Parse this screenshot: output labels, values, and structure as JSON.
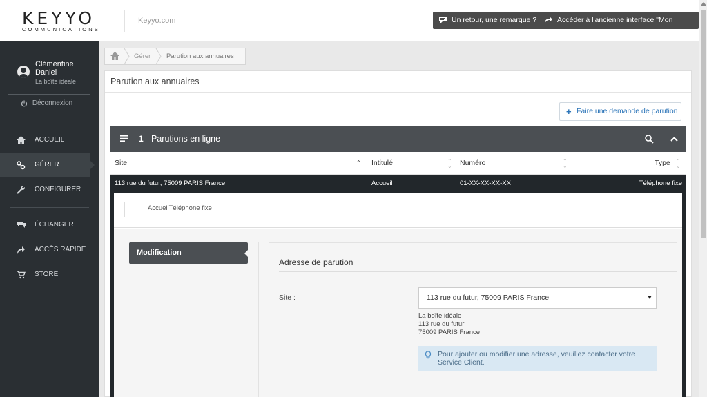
{
  "header": {
    "logo_main": "KEYYO",
    "logo_sub": "COMMUNICATIONS",
    "site_link": "Keyyo.com",
    "feedback_button": "Un retour, une remarque ?",
    "old_interface_button": "Accéder à l'ancienne interface \"Mon Compte\""
  },
  "user": {
    "name": "Clémentine Daniel",
    "company": "La boîte idéale",
    "logout_label": "Déconnexion"
  },
  "nav": {
    "items": [
      {
        "label": "ACCUEIL",
        "icon": "home-icon"
      },
      {
        "label": "GÉRER",
        "icon": "manage-icon",
        "active": true
      },
      {
        "label": "CONFIGURER",
        "icon": "wrench-icon"
      },
      {
        "label": "ÉCHANGER",
        "icon": "chat-icon"
      },
      {
        "label": "ACCÈS RAPIDE",
        "icon": "shortcut-icon"
      },
      {
        "label": "STORE",
        "icon": "cart-icon"
      }
    ]
  },
  "breadcrumb": {
    "items": [
      "Gérer",
      "Parution aux annuaires"
    ]
  },
  "page": {
    "title": "Parution aux annuaires",
    "request_button": "Faire une demande de parution"
  },
  "panel": {
    "count": "1",
    "title": "Parutions en ligne",
    "columns": [
      "Site",
      "Intitulé",
      "Numéro",
      "Type"
    ],
    "rows": [
      {
        "site": "113 rue du futur, 75009 PARIS France",
        "intitule": "Accueil",
        "numero": "01-XX-XX-XX-XX",
        "type": "Téléphone fixe"
      }
    ],
    "detail_summary": "AccueilTéléphone fixe"
  },
  "form": {
    "tab_label": "Modification",
    "section_title": "Adresse de parution",
    "site_label": "Site :",
    "site_value": "113 rue du futur, 75009 PARIS France",
    "address_lines": [
      "La boîte idéale",
      "113 rue du futur",
      "75009 PARIS France"
    ],
    "info_text": "Pour ajouter ou modifier une adresse, veuillez contacter votre Service Client."
  },
  "colors": {
    "sidebar_bg": "#2a2f33",
    "panel_header_bg": "#4b4f53",
    "accent_blue": "#2b74b8",
    "info_bg": "#d9e8f3"
  }
}
